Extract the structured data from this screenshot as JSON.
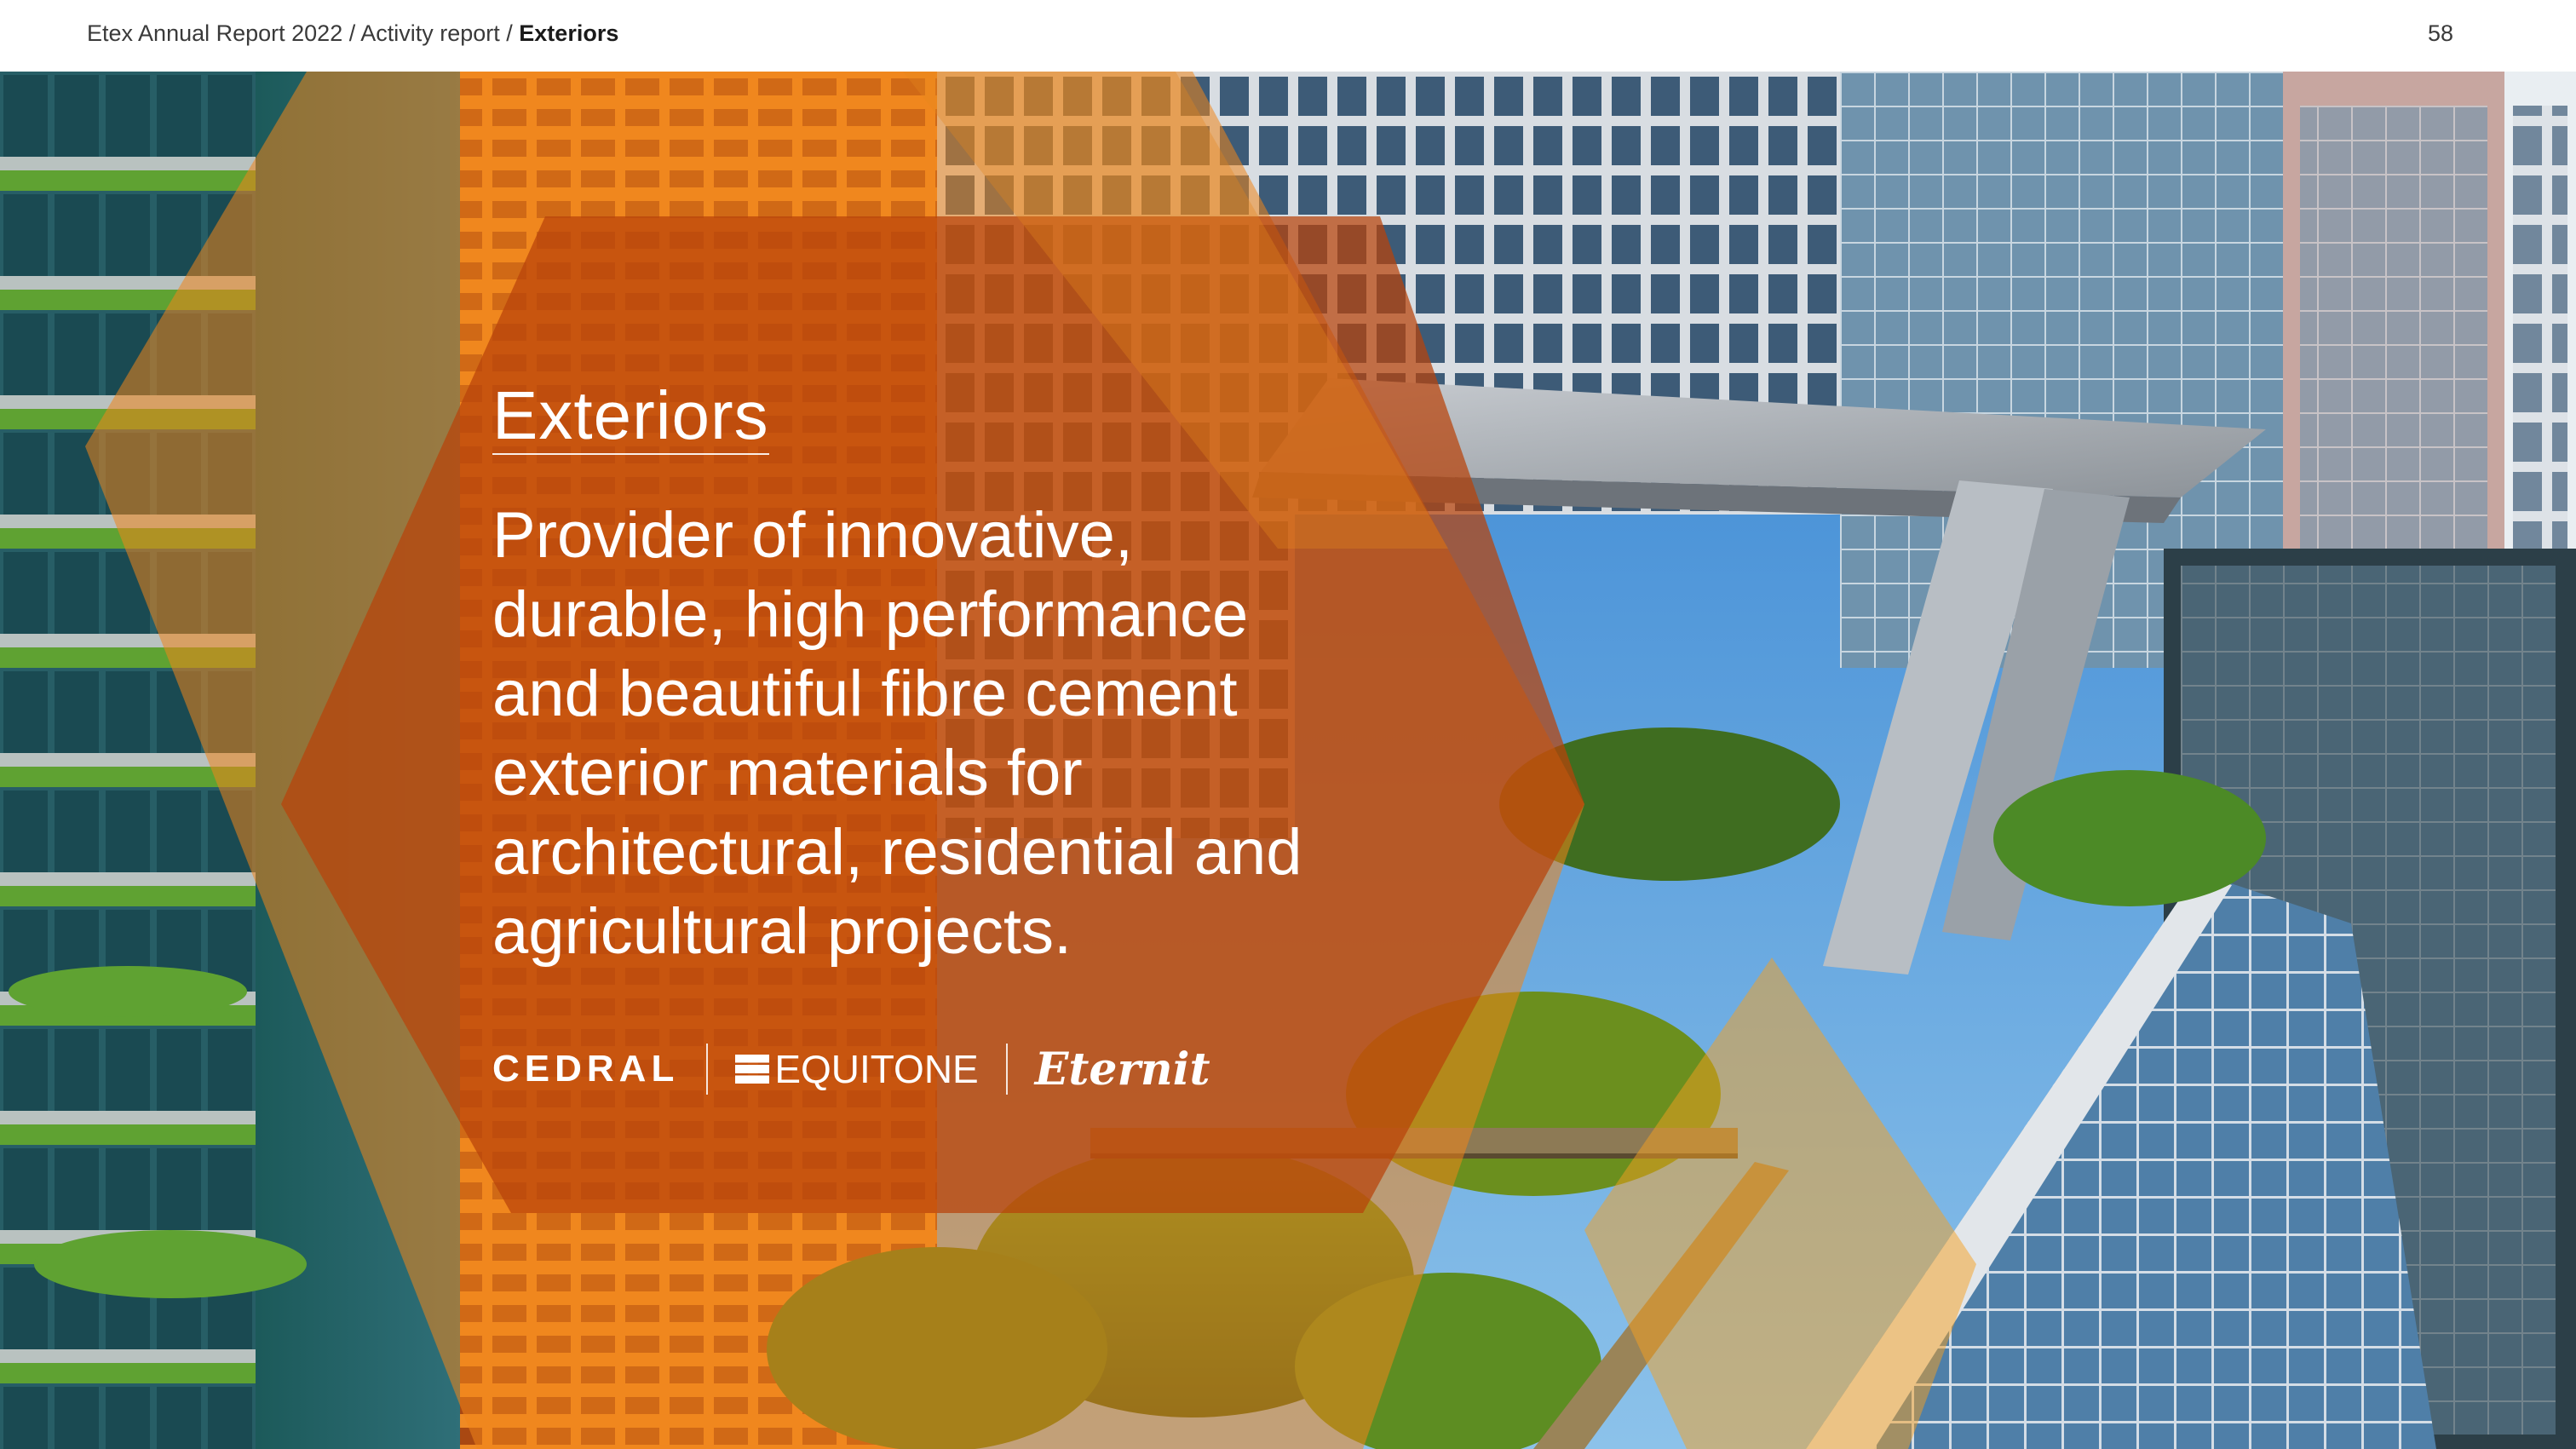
{
  "header": {
    "breadcrumb_prefix": "Etex Annual Report 2022 / Activity report / ",
    "breadcrumb_current": "Exteriors",
    "page_number": "58"
  },
  "main": {
    "title": "Exteriors",
    "description": "Provider of innovative, durable, high performance and beautiful fibre cement exterior materials for architectural, residential and agricultural projects."
  },
  "brands": [
    {
      "name": "CEDRAL"
    },
    {
      "name": "EQUITONE"
    },
    {
      "name": "Eternit"
    }
  ],
  "colors": {
    "hexagon_orange": "#e0700f",
    "hexagon_dark": "#a83d08",
    "amber": "#f5a020",
    "sky": "#3a88cf",
    "glass": "#6a8fa6"
  }
}
